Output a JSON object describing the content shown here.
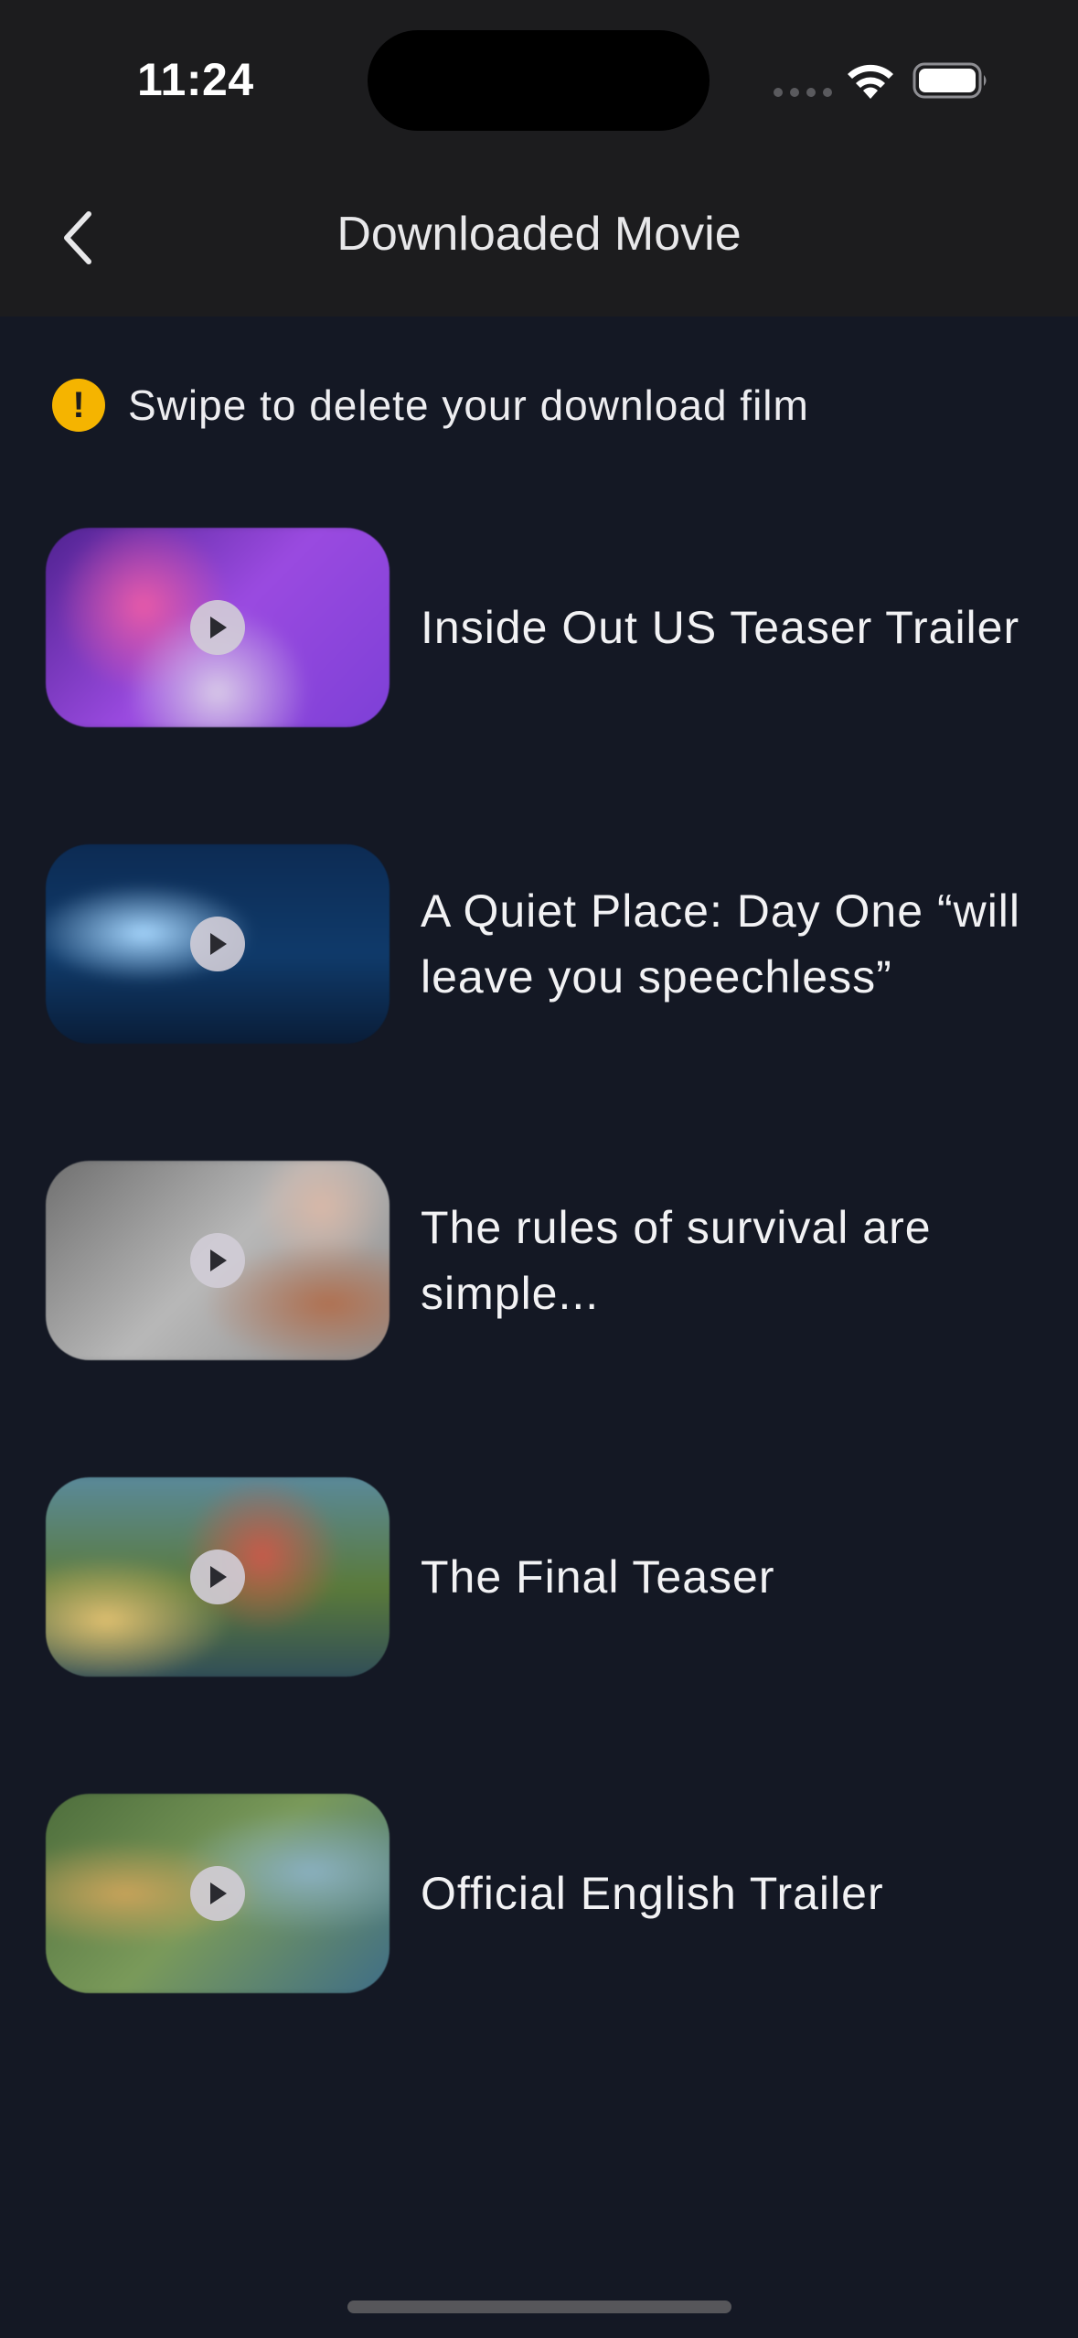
{
  "status_bar": {
    "time": "11:24"
  },
  "header": {
    "title": "Downloaded Movie",
    "back_icon": "chevron-left-icon"
  },
  "notice": {
    "icon": "warning-icon",
    "text": "Swipe to delete your download film",
    "accent_color": "#f5b400"
  },
  "movies": [
    {
      "title": "Inside Out US Teaser Trailer",
      "thumb_palette": [
        "#7b3fd6",
        "#c978e8",
        "#4a1f8a"
      ]
    },
    {
      "title": "A Quiet Place: Day One “will leave you speechless”",
      "thumb_palette": [
        "#0c2a52",
        "#3a7bbd",
        "#091a33"
      ]
    },
    {
      "title": "The rules of survival are simple...",
      "thumb_palette": [
        "#8a8a8a",
        "#c9c9c9",
        "#5a5a5a"
      ]
    },
    {
      "title": "The Final Teaser",
      "thumb_palette": [
        "#4f7a4a",
        "#c98a3a",
        "#2d5a7a"
      ]
    },
    {
      "title": "Official English Trailer",
      "thumb_palette": [
        "#6a8a4a",
        "#c9a35a",
        "#3a6a8a"
      ]
    }
  ],
  "colors": {
    "background": "#141824",
    "header": "#1c1c1e"
  }
}
